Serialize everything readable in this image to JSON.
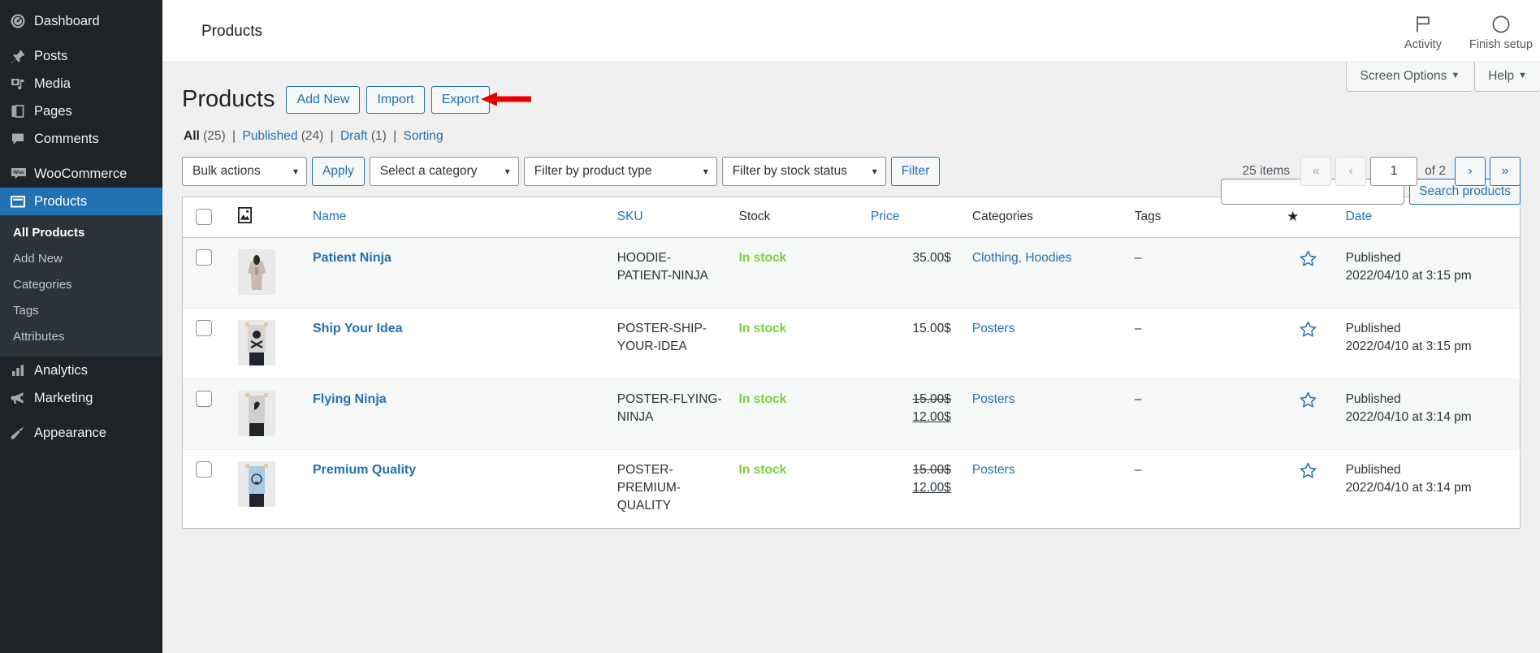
{
  "sidebar": {
    "groups": [
      {
        "items": [
          {
            "label": "Dashboard",
            "icon": "dashboard-icon",
            "current": false
          }
        ]
      },
      {
        "items": [
          {
            "label": "Posts",
            "icon": "pin-icon",
            "current": false
          },
          {
            "label": "Media",
            "icon": "media-icon",
            "current": false
          },
          {
            "label": "Pages",
            "icon": "pages-icon",
            "current": false
          },
          {
            "label": "Comments",
            "icon": "comments-icon",
            "current": false
          }
        ]
      },
      {
        "items": [
          {
            "label": "WooCommerce",
            "icon": "woo-icon",
            "current": false
          },
          {
            "label": "Products",
            "icon": "products-icon",
            "current": true
          }
        ]
      }
    ],
    "submenu": [
      {
        "label": "All Products",
        "current": true
      },
      {
        "label": "Add New",
        "current": false
      },
      {
        "label": "Categories",
        "current": false
      },
      {
        "label": "Tags",
        "current": false
      },
      {
        "label": "Attributes",
        "current": false
      }
    ],
    "after_submenu": [
      {
        "label": "Analytics",
        "icon": "analytics-icon"
      },
      {
        "label": "Marketing",
        "icon": "marketing-icon"
      }
    ],
    "last_group": [
      {
        "label": "Appearance",
        "icon": "appearance-icon"
      }
    ]
  },
  "woo_header": {
    "title": "Products",
    "activity_label": "Activity",
    "activity_icon": "flag-icon",
    "finish_setup_label": "Finish setup",
    "finish_setup_icon": "circle-progress-icon"
  },
  "screen_meta": {
    "screen_options_label": "Screen Options",
    "help_label": "Help",
    "caret": "▼"
  },
  "page": {
    "title": "Products",
    "actions": [
      {
        "label": "Add New",
        "name": "add-new-button"
      },
      {
        "label": "Import",
        "name": "import-button"
      },
      {
        "label": "Export",
        "name": "export-button"
      }
    ],
    "annotation": {
      "type": "red-arrow",
      "points_to": "Export"
    }
  },
  "status_filters": {
    "all": {
      "label": "All",
      "count": "(25)",
      "current": true
    },
    "published": {
      "label": "Published",
      "count": "(24)",
      "current": false
    },
    "draft": {
      "label": "Draft",
      "count": "(1)",
      "current": false
    },
    "sorting": {
      "label": "Sorting",
      "count": "",
      "current": false
    },
    "separator": "|"
  },
  "search": {
    "value": "",
    "placeholder": "",
    "button_label": "Search products"
  },
  "tablenav": {
    "bulk_actions_label": "Bulk actions",
    "apply_label": "Apply",
    "category_label": "Select a category",
    "product_type_label": "Filter by product type",
    "stock_status_label": "Filter by stock status",
    "filter_label": "Filter",
    "displaying_num": "25 items",
    "first_page": "«",
    "prev_page": "‹",
    "current_page": "1",
    "total_pages_label": "of 2",
    "next_page": "›",
    "last_page": "»"
  },
  "table": {
    "columns": [
      {
        "key": "cb",
        "label": "",
        "sortable": false,
        "link": false
      },
      {
        "key": "thumb",
        "label": "",
        "sortable": false,
        "link": false,
        "icon": "image-icon"
      },
      {
        "key": "name",
        "label": "Name",
        "link": true
      },
      {
        "key": "sku",
        "label": "SKU",
        "link": true
      },
      {
        "key": "stock",
        "label": "Stock",
        "link": false
      },
      {
        "key": "price",
        "label": "Price",
        "link": true
      },
      {
        "key": "categories",
        "label": "Categories",
        "link": false
      },
      {
        "key": "tags",
        "label": "Tags",
        "link": false
      },
      {
        "key": "featured",
        "label": "",
        "link": false,
        "icon": "star-filled-icon"
      },
      {
        "key": "date",
        "label": "Date",
        "link": true
      }
    ],
    "rows": [
      {
        "name": "Patient Ninja",
        "thumb": "hoodie-beige",
        "sku": "HOODIE-PATIENT-NINJA",
        "stock": "In stock",
        "price": "35.00$",
        "price_regular": "",
        "price_sale": "",
        "categories": "Clothing, Hoodies",
        "tags": "–",
        "featured": "star-outline",
        "date_status": "Published",
        "date_value": "2022/04/10 at 3:15 pm"
      },
      {
        "name": "Ship Your Idea",
        "thumb": "poster-skull",
        "sku": "POSTER-SHIP-YOUR-IDEA",
        "stock": "In stock",
        "price": "15.00$",
        "price_regular": "",
        "price_sale": "",
        "categories": "Posters",
        "tags": "–",
        "featured": "star-outline",
        "date_status": "Published",
        "date_value": "2022/04/10 at 3:15 pm"
      },
      {
        "name": "Flying Ninja",
        "thumb": "poster-ninja",
        "sku": "POSTER-FLYING-NINJA",
        "stock": "In stock",
        "price": "",
        "price_regular": "15.00$",
        "price_sale": "12.00$",
        "categories": "Posters",
        "tags": "–",
        "featured": "star-outline",
        "date_status": "Published",
        "date_value": "2022/04/10 at 3:14 pm"
      },
      {
        "name": "Premium Quality",
        "thumb": "poster-blue",
        "sku": "POSTER-PREMIUM-QUALITY",
        "stock": "In stock",
        "price": "",
        "price_regular": "15.00$",
        "price_sale": "12.00$",
        "categories": "Posters",
        "tags": "–",
        "featured": "star-outline",
        "date_status": "Published",
        "date_value": "2022/04/10 at 3:14 pm"
      }
    ]
  },
  "colors": {
    "sidebar_bg": "#1d2327",
    "sidebar_submenu_bg": "#2c3338",
    "accent_blue": "#2271b1",
    "current_menu_bg": "#2271b1",
    "in_stock_green": "#7ad03a",
    "annotation_red": "#e60000",
    "body_bg": "#f0f0f1"
  }
}
